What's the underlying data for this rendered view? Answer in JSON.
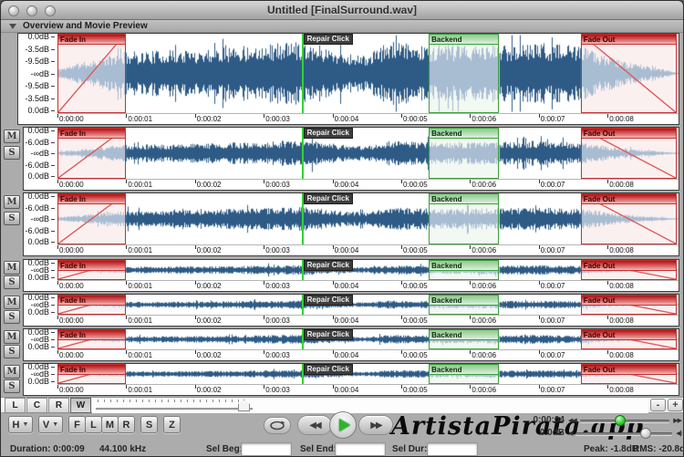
{
  "window": {
    "title": "Untitled [FinalSurround.wav]"
  },
  "overview_header": {
    "label": "Overview and Movie Preview"
  },
  "timeline": {
    "ruler_labels": [
      "0:00:00",
      "0:00:01",
      "0:00:02",
      "0:00:03",
      "0:00:04",
      "0:00:05",
      "0:00:06",
      "0:00:07",
      "0:00:08"
    ],
    "duration_seconds": 9.0
  },
  "markers": {
    "fade_in": {
      "label": "Fade In",
      "start_s": 0.0,
      "end_s": 0.99
    },
    "repair_click": {
      "label": "Repair Click",
      "time_s": 3.55
    },
    "backend": {
      "label": "Backend",
      "start_s": 5.4,
      "end_s": 6.42
    },
    "fade_out": {
      "label": "Fade Out",
      "start_s": 7.61,
      "end_s": 9.0
    }
  },
  "tracks": [
    {
      "id": "overview",
      "db_labels": [
        "0.0dB",
        "-3.5dB",
        "-9.5dB",
        "-∞dB",
        "-9.5dB",
        "-3.5dB",
        "0.0dB"
      ],
      "has_ms": false
    },
    {
      "id": "channel-1",
      "db_labels": [
        "0.0dB",
        "-6.0dB",
        "-∞dB",
        "-6.0dB",
        "0.0dB"
      ],
      "has_ms": true
    },
    {
      "id": "channel-2",
      "db_labels": [
        "0.0dB",
        "-6.0dB",
        "-∞dB",
        "-6.0dB",
        "0.0dB"
      ],
      "has_ms": true
    },
    {
      "id": "channel-3",
      "db_labels": [
        "0.0dB",
        "-∞dB",
        "0.0dB"
      ],
      "has_ms": true
    },
    {
      "id": "channel-4",
      "db_labels": [
        "0.0dB",
        "-∞dB",
        "0.0dB"
      ],
      "has_ms": true
    },
    {
      "id": "channel-5",
      "db_labels": [
        "0.0dB",
        "-∞dB",
        "0.0dB"
      ],
      "has_ms": true
    },
    {
      "id": "channel-6",
      "db_labels": [
        "0.0dB",
        "-∞dB",
        "0.0dB"
      ],
      "has_ms": true
    }
  ],
  "ms_buttons": {
    "mute": "M",
    "solo": "S"
  },
  "channel_selector": {
    "buttons": [
      "L",
      "C",
      "R",
      "W"
    ],
    "active": "W"
  },
  "zoom_controls": {
    "minus": "-",
    "plus": "+"
  },
  "toolbar": {
    "h_label": "H",
    "v_label": "V",
    "buttons": [
      "F",
      "L",
      "M",
      "R",
      "S",
      "Z"
    ]
  },
  "transport": {
    "loop": "loop",
    "rewind": "rewind",
    "play": "play",
    "fast_forward": "fast-forward"
  },
  "watermark": "ArtistaPirata.app",
  "playback": {
    "position": "0:00:04",
    "volume": "0.0dB"
  },
  "status": {
    "duration": "Duration: 0:00:09",
    "sample_rate": "44.100 kHz",
    "sel_beg_label": "Sel Beg:",
    "sel_end_label": "Sel End:",
    "sel_dur_label": "Sel Dur:",
    "peak": "Peak: -1.8dB",
    "rms": "RMS: -20.8dB"
  },
  "colors": {
    "waveform": "#2e5b86",
    "waveform_selected": "#a9bdd2",
    "fade_fill": "#fbf0f0",
    "backend_fill": "#f2f8f2",
    "fade_border": "#c53030",
    "backend_border": "#3d9e3d",
    "repair_line": "#2fd42f",
    "play_green": "#2db52d"
  }
}
